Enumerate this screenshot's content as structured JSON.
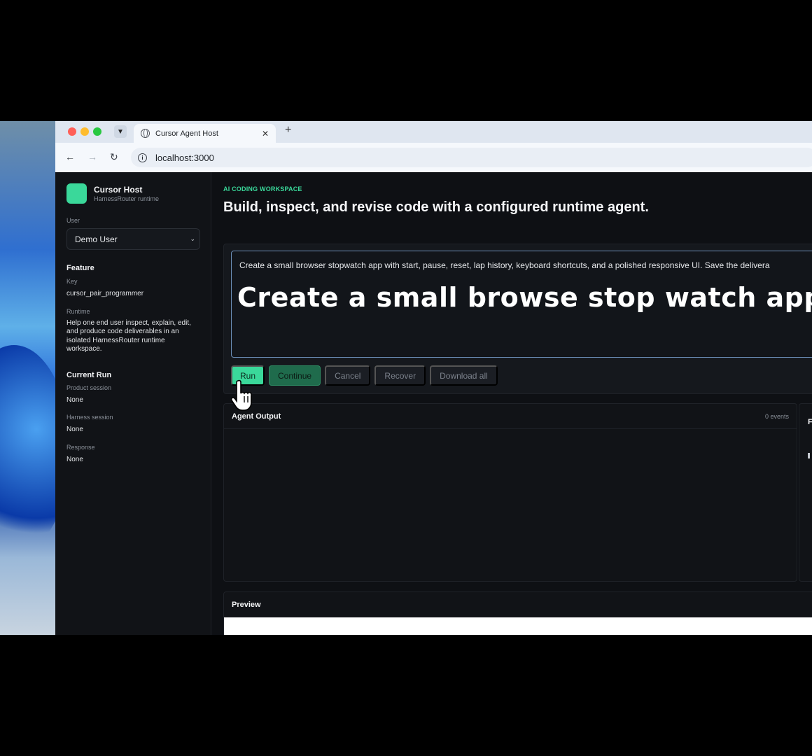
{
  "browser": {
    "tab_title": "Cursor Agent Host",
    "tab_close": "✕",
    "new_tab": "+",
    "url": "localhost:3000"
  },
  "sidebar": {
    "brand_name": "Cursor Host",
    "brand_sub": "HarnessRouter runtime",
    "user_label": "User",
    "user_value": "Demo User",
    "feature_heading": "Feature",
    "key_label": "Key",
    "key_value": "cursor_pair_programmer",
    "runtime_label": "Runtime",
    "runtime_value": "Help one end user inspect, explain, edit, and produce code deliverables in an isolated HarnessRouter runtime workspace.",
    "current_run_heading": "Current Run",
    "product_session_label": "Product session",
    "product_session_value": "None",
    "harness_session_label": "Harness session",
    "harness_session_value": "None",
    "response_label": "Response",
    "response_value": "None"
  },
  "main": {
    "eyebrow": "AI CODING WORKSPACE",
    "title": "Build, inspect, and revise code with a configured runtime agent.",
    "prompt_text": "Create a small browser stopwatch app with start, pause, reset, lap history, keyboard shortcuts, and a polished responsive UI. Save the delivera",
    "caption_overlay": "Create a small browse stop watch app",
    "buttons": {
      "run": "Run",
      "continue": "Continue",
      "cancel": "Cancel",
      "recover": "Recover",
      "download_all": "Download all"
    },
    "output_title": "Agent Output",
    "events_count": "0 events",
    "side_card_letter": "F",
    "preview_title": "Preview"
  },
  "colors": {
    "accent": "#3ad89a",
    "background": "#0e1014",
    "sidebar_bg": "#111317",
    "prompt_border": "#6c8fb8"
  },
  "icons": [
    "globe-icon",
    "back-arrow-icon",
    "forward-arrow-icon",
    "reload-icon",
    "info-icon",
    "chevron-down-icon",
    "hand-cursor-icon"
  ]
}
